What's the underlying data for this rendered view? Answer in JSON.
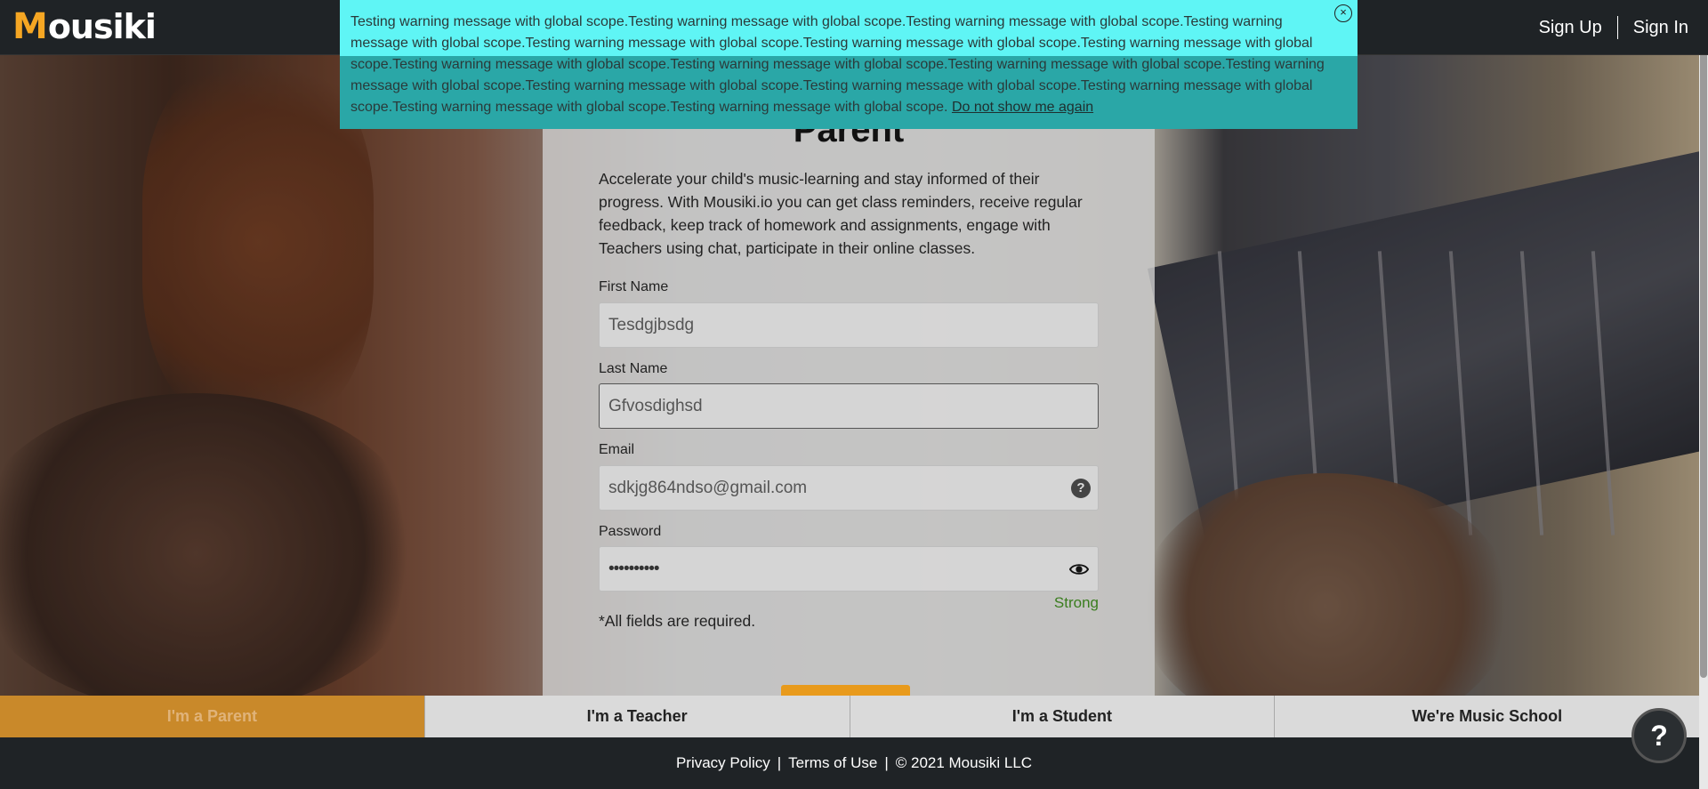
{
  "header": {
    "logo_first": "M",
    "logo_rest": "ousiki",
    "signup": "Sign Up",
    "signin": "Sign In"
  },
  "banner": {
    "message": "Testing warning message with global scope.Testing warning message with global scope.Testing warning message with global scope.Testing warning message with global scope.Testing warning message with global scope.Testing warning message with global scope.Testing warning message with global scope.Testing warning message with global scope.Testing warning message with global scope.Testing warning message with global scope.Testing warning message with global scope.Testing warning message with global scope.Testing warning message with global scope.Testing warning message with global scope.Testing warning message with global scope.Testing warning message with global scope.",
    "dismiss": "Do not show me again",
    "close_icon": "×"
  },
  "form": {
    "title": "Parent",
    "description": "Accelerate your child's music-learning and stay informed of their progress. With Mousiki.io you can get class reminders, receive regular feedback, keep track of homework and assignments, engage with Teachers using chat, participate in their online classes.",
    "first_name_label": "First Name",
    "first_name_value": "Tesdgjbsdg",
    "last_name_label": "Last Name",
    "last_name_value": "Gfvosdighsd",
    "email_label": "Email",
    "email_value": "sdkjg864ndso@gmail.com",
    "email_help": "?",
    "password_label": "Password",
    "password_value": "••••••••••",
    "strength": "Strong",
    "required_note": "*All fields are required."
  },
  "tabs": [
    {
      "label": "I'm a Parent",
      "active": true
    },
    {
      "label": "I'm a Teacher",
      "active": false
    },
    {
      "label": "I'm a Student",
      "active": false
    },
    {
      "label": "We're Music School",
      "active": false
    }
  ],
  "footer": {
    "privacy": "Privacy Policy",
    "terms": "Terms of Use",
    "copyright": "© 2021 Mousiki LLC",
    "separator": "|"
  },
  "help_bubble": "?",
  "colors": {
    "brand_orange": "#f5a623",
    "banner_cyan": "#5ff5f5",
    "header_dark": "#1f2326",
    "strength_green": "#3a7d1e"
  }
}
